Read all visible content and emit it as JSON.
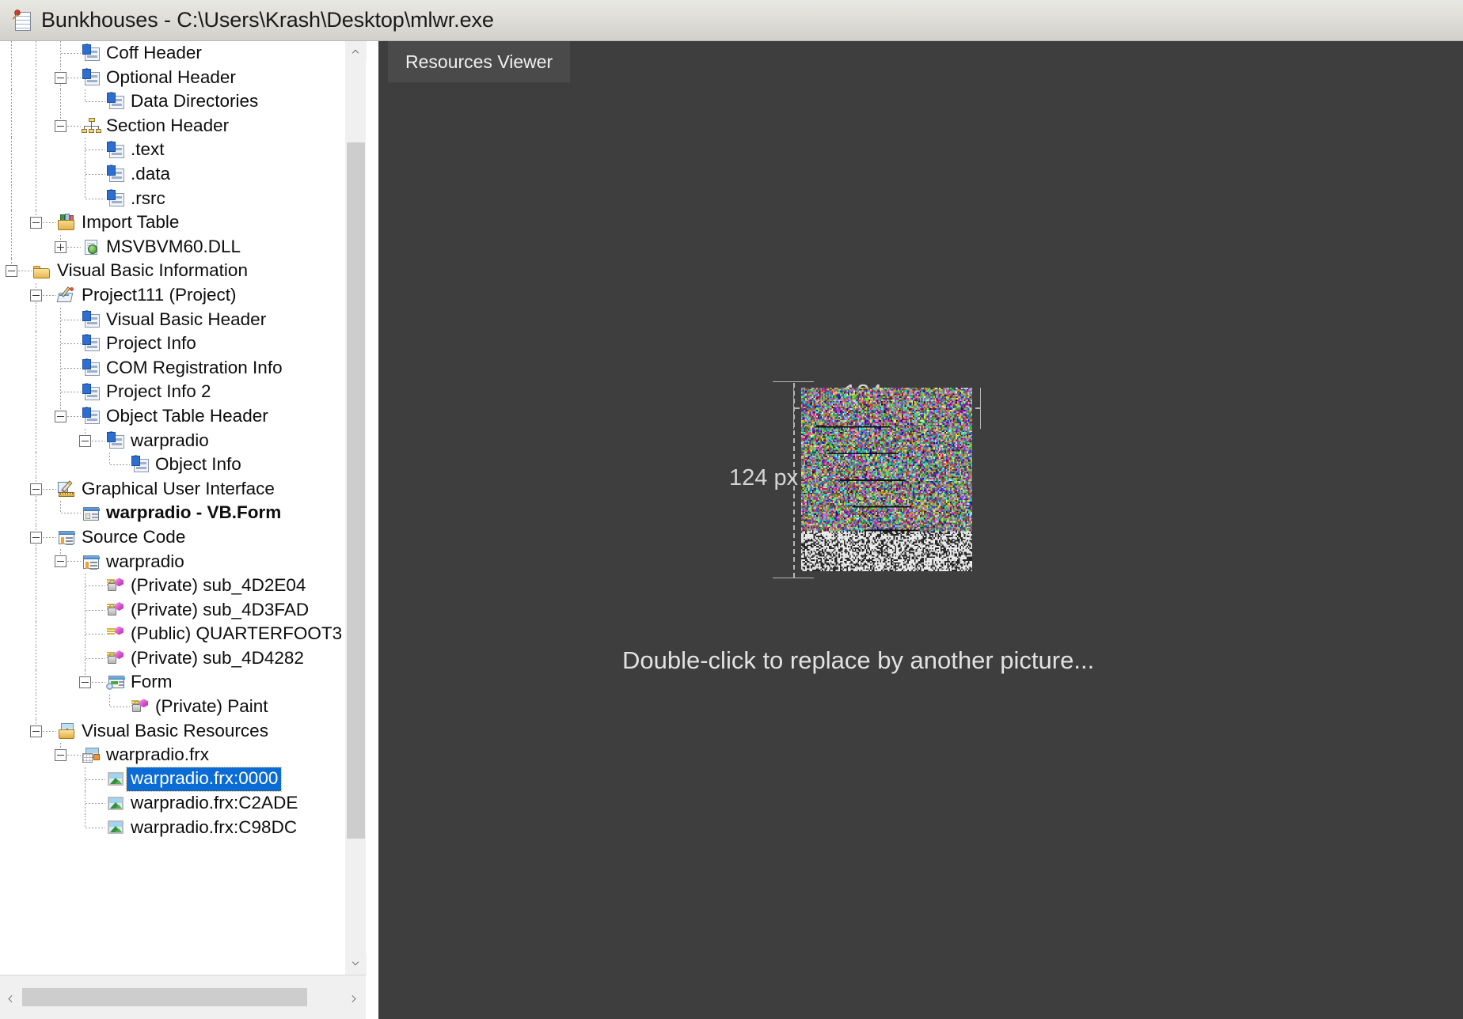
{
  "window": {
    "title": "Bunkhouses - C:\\Users\\Krash\\Desktop\\mlwr.exe",
    "app_icon": "notepad-pin-icon"
  },
  "tree": {
    "name": "pe-structure-tree",
    "scroll": {
      "vertical_up": "scroll-up-icon",
      "vertical_down": "scroll-down-icon",
      "horizontal_left": "scroll-left-icon",
      "horizontal_right": "scroll-right-icon"
    },
    "items": [
      {
        "label": "Coff Header",
        "depth": 3,
        "icon": "struct-record-icon",
        "toggle": "none",
        "style": "normal"
      },
      {
        "label": "Optional Header",
        "depth": 3,
        "icon": "struct-record-icon",
        "toggle": "minus",
        "style": "normal"
      },
      {
        "label": "Data Directories",
        "depth": 4,
        "icon": "struct-record-icon",
        "toggle": "none",
        "style": "normal"
      },
      {
        "label": "Section Header",
        "depth": 3,
        "icon": "section-header-icon",
        "toggle": "minus",
        "style": "normal"
      },
      {
        "label": ".text",
        "depth": 4,
        "icon": "struct-record-icon",
        "toggle": "none",
        "style": "normal"
      },
      {
        "label": ".data",
        "depth": 4,
        "icon": "struct-record-icon",
        "toggle": "none",
        "style": "normal"
      },
      {
        "label": ".rsrc",
        "depth": 4,
        "icon": "struct-record-icon",
        "toggle": "none",
        "style": "normal"
      },
      {
        "label": "Import Table",
        "depth": 2,
        "icon": "import-table-icon",
        "toggle": "minus",
        "style": "normal"
      },
      {
        "label": "MSVBVM60.DLL",
        "depth": 3,
        "icon": "dll-page-icon",
        "toggle": "plus",
        "style": "normal"
      },
      {
        "label": "Visual Basic Information",
        "depth": 1,
        "icon": "folder-icon",
        "toggle": "minus",
        "style": "normal"
      },
      {
        "label": "Project111 (Project)",
        "depth": 2,
        "icon": "project-icon",
        "toggle": "minus",
        "style": "normal"
      },
      {
        "label": "Visual Basic Header",
        "depth": 3,
        "icon": "struct-record-icon",
        "toggle": "none",
        "style": "normal"
      },
      {
        "label": "Project Info",
        "depth": 3,
        "icon": "struct-record-icon",
        "toggle": "none",
        "style": "normal"
      },
      {
        "label": "COM Registration Info",
        "depth": 3,
        "icon": "struct-record-icon",
        "toggle": "none",
        "style": "normal"
      },
      {
        "label": "Project Info 2",
        "depth": 3,
        "icon": "struct-record-icon",
        "toggle": "none",
        "style": "normal"
      },
      {
        "label": "Object Table Header",
        "depth": 3,
        "icon": "struct-record-icon",
        "toggle": "minus",
        "style": "normal"
      },
      {
        "label": "warpradio",
        "depth": 4,
        "icon": "struct-record-icon",
        "toggle": "minus",
        "style": "normal"
      },
      {
        "label": "Object Info",
        "depth": 5,
        "icon": "struct-record-icon",
        "toggle": "none",
        "style": "normal"
      },
      {
        "label": "Graphical User Interface",
        "depth": 2,
        "icon": "gui-design-icon",
        "toggle": "minus",
        "style": "normal"
      },
      {
        "label": "warpradio - VB.Form",
        "depth": 3,
        "icon": "form-icon",
        "toggle": "none",
        "style": "bold"
      },
      {
        "label": "Source Code",
        "depth": 2,
        "icon": "source-code-icon",
        "toggle": "minus",
        "style": "normal"
      },
      {
        "label": "warpradio",
        "depth": 3,
        "icon": "source-code-icon",
        "toggle": "minus",
        "style": "normal"
      },
      {
        "label": "(Private) sub_4D2E04",
        "depth": 4,
        "icon": "private-proc-icon",
        "toggle": "none",
        "style": "normal"
      },
      {
        "label": "(Private) sub_4D3FAD",
        "depth": 4,
        "icon": "private-proc-icon",
        "toggle": "none",
        "style": "normal"
      },
      {
        "label": "(Public) QUARTERFOOT3",
        "depth": 4,
        "icon": "public-proc-icon",
        "toggle": "none",
        "style": "normal"
      },
      {
        "label": "(Private) sub_4D4282",
        "depth": 4,
        "icon": "private-proc-icon",
        "toggle": "none",
        "style": "normal"
      },
      {
        "label": "Form",
        "depth": 4,
        "icon": "form-green-icon",
        "toggle": "minus",
        "style": "normal"
      },
      {
        "label": "(Private) Paint",
        "depth": 5,
        "icon": "private-proc-icon",
        "toggle": "none",
        "style": "normal"
      },
      {
        "label": "Visual Basic Resources",
        "depth": 2,
        "icon": "vb-resources-icon",
        "toggle": "minus",
        "style": "normal"
      },
      {
        "label": "warpradio.frx",
        "depth": 3,
        "icon": "frx-file-icon",
        "toggle": "minus",
        "style": "normal"
      },
      {
        "label": "warpradio.frx:0000",
        "depth": 4,
        "icon": "bitmap-icon",
        "toggle": "none",
        "style": "selected"
      },
      {
        "label": "warpradio.frx:C2ADE",
        "depth": 4,
        "icon": "bitmap-icon",
        "toggle": "none",
        "style": "normal"
      },
      {
        "label": "warpradio.frx:C98DC",
        "depth": 4,
        "icon": "bitmap-icon",
        "toggle": "none",
        "style": "normal"
      }
    ]
  },
  "viewer": {
    "tab_label": "Resources Viewer",
    "width_label": "124 px",
    "height_label": "124 px",
    "hint": "Double-click to replace by another picture...",
    "image_name": "noise-preview-image"
  },
  "colors": {
    "selection": "#0a6cd4",
    "selection_focus_outline": "#ffb84d",
    "viewer_background": "#3e3e3e",
    "tab_background": "#4a4a4a",
    "titlebar_background": "#dedcd6",
    "guide_line": "#b6b6b6"
  }
}
